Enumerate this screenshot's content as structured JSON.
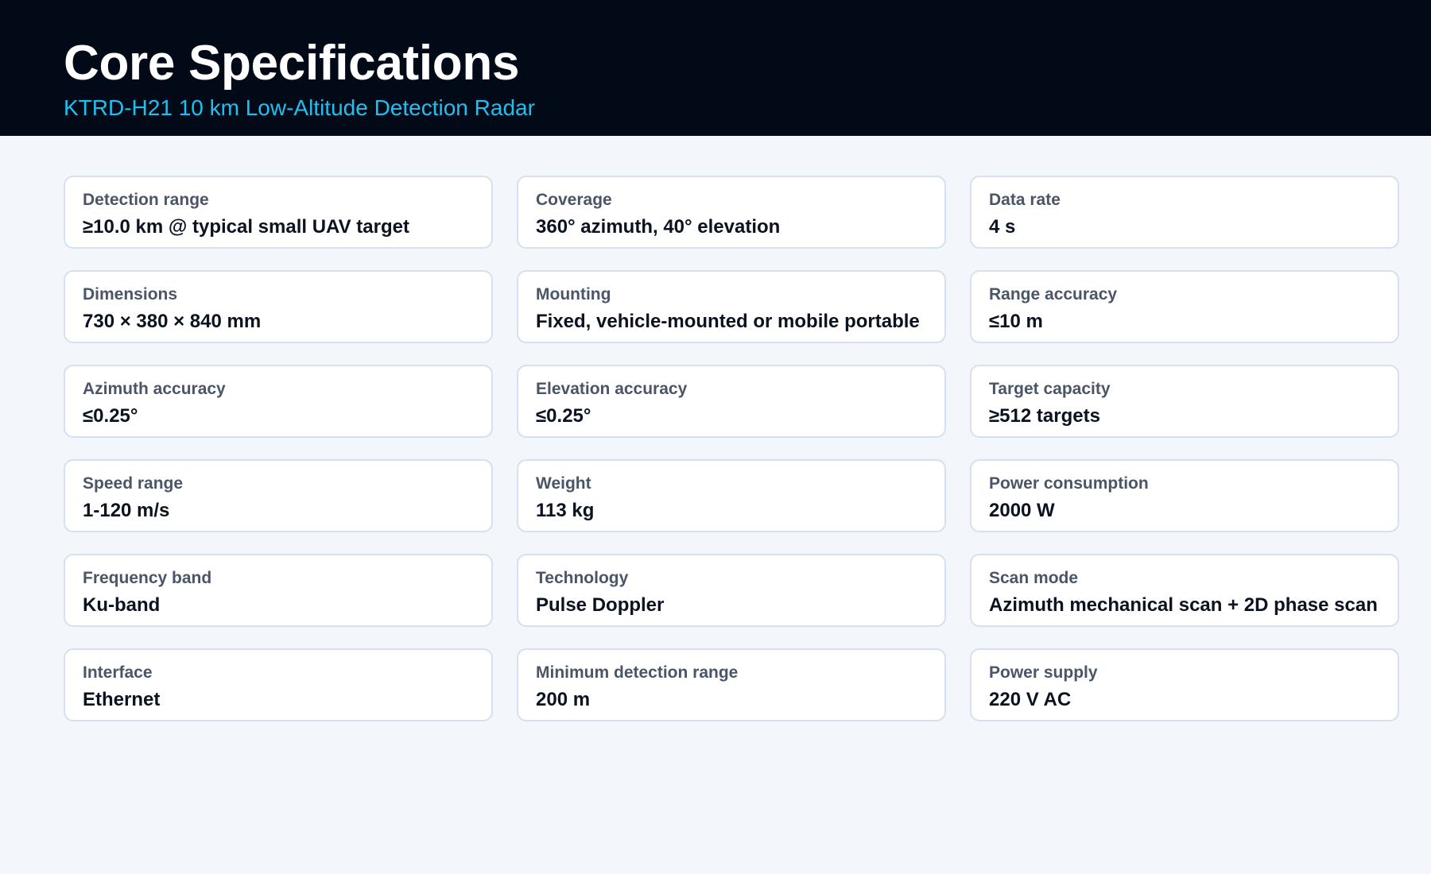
{
  "header": {
    "title": "Core Specifications",
    "subtitle": "KTRD-H21 10 km Low-Altitude Detection Radar"
  },
  "specs": [
    {
      "label": "Detection range",
      "value": "≥10.0 km @ typical small UAV target"
    },
    {
      "label": "Coverage",
      "value": "360° azimuth, 40° elevation"
    },
    {
      "label": "Data rate",
      "value": "4 s"
    },
    {
      "label": "Dimensions",
      "value": "730 × 380 × 840 mm"
    },
    {
      "label": "Mounting",
      "value": "Fixed, vehicle-mounted or mobile portable"
    },
    {
      "label": "Range accuracy",
      "value": "≤10 m"
    },
    {
      "label": "Azimuth accuracy",
      "value": "≤0.25°"
    },
    {
      "label": "Elevation accuracy",
      "value": "≤0.25°"
    },
    {
      "label": "Target capacity",
      "value": "≥512 targets"
    },
    {
      "label": "Speed range",
      "value": "1-120 m/s"
    },
    {
      "label": "Weight",
      "value": "113 kg"
    },
    {
      "label": "Power consumption",
      "value": "2000 W"
    },
    {
      "label": "Frequency band",
      "value": "Ku-band"
    },
    {
      "label": "Technology",
      "value": "Pulse Doppler"
    },
    {
      "label": "Scan mode",
      "value": "Azimuth mechanical scan + 2D phase scan"
    },
    {
      "label": "Interface",
      "value": "Ethernet"
    },
    {
      "label": "Minimum detection range",
      "value": "200 m"
    },
    {
      "label": "Power supply",
      "value": "220 V AC"
    }
  ]
}
